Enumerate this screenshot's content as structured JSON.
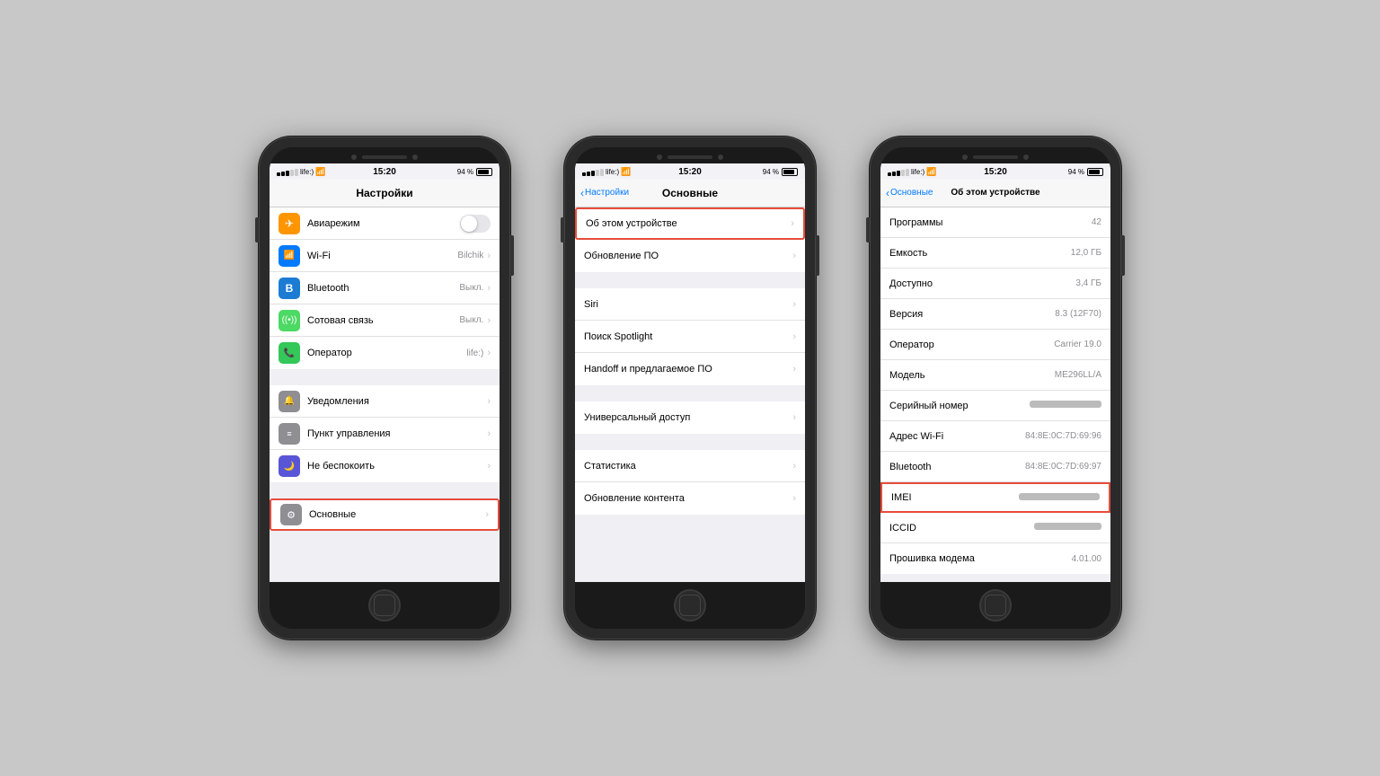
{
  "phone1": {
    "status": {
      "carrier": "●●●○○ life:)",
      "wifi": "WiFi",
      "time": "15:20",
      "battery_pct": "94 %",
      "signal": "life:)"
    },
    "nav": {
      "title": "Настройки"
    },
    "groups": [
      {
        "items": [
          {
            "icon": "airplane",
            "icon_color": "icon-orange",
            "label": "Авиарежим",
            "type": "toggle",
            "value": ""
          },
          {
            "icon": "wifi",
            "icon_color": "icon-blue",
            "label": "Wi-Fi",
            "type": "chevron",
            "value": "Bilchik"
          },
          {
            "icon": "bluetooth",
            "icon_color": "icon-blue-dark",
            "label": "Bluetooth",
            "type": "chevron",
            "value": "Выкл."
          },
          {
            "icon": "cellular",
            "icon_color": "icon-green",
            "label": "Сотовая связь",
            "type": "chevron",
            "value": "Выкл."
          },
          {
            "icon": "phone",
            "icon_color": "icon-green-dark",
            "label": "Оператор",
            "type": "chevron",
            "value": "life:)"
          }
        ]
      },
      {
        "items": [
          {
            "icon": "notif",
            "icon_color": "icon-gray",
            "label": "Уведомления",
            "type": "chevron",
            "value": ""
          },
          {
            "icon": "control",
            "icon_color": "icon-gray",
            "label": "Пункт управления",
            "type": "chevron",
            "value": ""
          },
          {
            "icon": "moon",
            "icon_color": "icon-purple",
            "label": "Не беспокоить",
            "type": "chevron",
            "value": ""
          }
        ]
      },
      {
        "items": [
          {
            "icon": "gear",
            "icon_color": "icon-gray",
            "label": "Основные",
            "type": "chevron",
            "value": "",
            "highlighted": true
          }
        ]
      }
    ]
  },
  "phone2": {
    "status": {
      "carrier": "●●●○○ life:)",
      "time": "15:20",
      "battery_pct": "94 %"
    },
    "nav": {
      "back": "Настройки",
      "title": "Основные"
    },
    "groups": [
      {
        "items": [
          {
            "label": "Об этом устройстве",
            "type": "chevron",
            "highlighted": true
          },
          {
            "label": "Обновление ПО",
            "type": "chevron"
          }
        ]
      },
      {
        "items": [
          {
            "label": "Siri",
            "type": "chevron"
          },
          {
            "label": "Поиск Spotlight",
            "type": "chevron"
          },
          {
            "label": "Handoff и предлагаемое ПО",
            "type": "chevron"
          }
        ]
      },
      {
        "items": [
          {
            "label": "Универсальный доступ",
            "type": "chevron"
          }
        ]
      },
      {
        "items": [
          {
            "label": "Статистика",
            "type": "chevron"
          },
          {
            "label": "Обновление контента",
            "type": "chevron"
          }
        ]
      }
    ]
  },
  "phone3": {
    "status": {
      "carrier": "●●●○○ life:)",
      "time": "15:20",
      "battery_pct": "94 %"
    },
    "nav": {
      "back": "Основные",
      "title": "Об этом устройстве"
    },
    "items": [
      {
        "label": "Программы",
        "value": "42"
      },
      {
        "label": "Емкость",
        "value": "12,0 ГБ"
      },
      {
        "label": "Доступно",
        "value": "3,4 ГБ"
      },
      {
        "label": "Версия",
        "value": "8.3 (12F70)"
      },
      {
        "label": "Оператор",
        "value": "Carrier 19.0"
      },
      {
        "label": "Модель",
        "value": "ME296LL/A"
      },
      {
        "label": "Серийный номер",
        "value": "blurred"
      },
      {
        "label": "Адрес Wi-Fi",
        "value": "84:8E:0C:7D:69:96"
      },
      {
        "label": "Bluetooth",
        "value": "84:8E:0C:7D:69:97"
      },
      {
        "label": "IMEI",
        "value": "blurred",
        "highlighted": true
      },
      {
        "label": "ICCID",
        "value": "blurred"
      },
      {
        "label": "Прошивка модема",
        "value": "4.01.00"
      }
    ]
  },
  "icons": {
    "airplane": "✈",
    "wifi": "📶",
    "bluetooth": "B",
    "cellular": "📡",
    "phone": "📞",
    "notif": "🔔",
    "control": "☰",
    "moon": "🌙",
    "gear": "⚙"
  }
}
